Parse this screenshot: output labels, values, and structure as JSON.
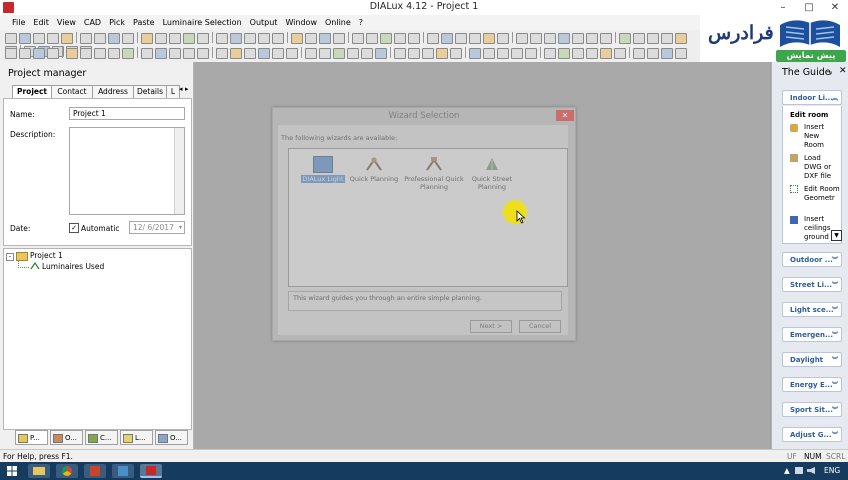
{
  "window": {
    "title": "DIALux 4.12 - Project 1",
    "buttons": {
      "minimize": "–",
      "maximize": "□",
      "close": "✕"
    }
  },
  "menu": [
    "File",
    "Edit",
    "View",
    "CAD",
    "Pick",
    "Paste",
    "Luminaire Selection",
    "Output",
    "Window",
    "Online",
    "?"
  ],
  "logo": {
    "text": "فرادرس",
    "subtitle": "پیش نمایش",
    "color": "#1e3a78",
    "badge_color": "#3da64a"
  },
  "project_manager": {
    "title": "Project manager",
    "tabs": [
      "Project",
      "Contact",
      "Address",
      "Details",
      "L"
    ],
    "active_tab": "Project",
    "form": {
      "name_label": "Name:",
      "name_value": "Project 1",
      "description_label": "Description:",
      "date_label": "Date:",
      "automatic_label": "Automatic",
      "automatic_checked": true,
      "date_value": "12/ 6/2017"
    },
    "tree": {
      "root": "Project 1",
      "child": "Luminaires Used"
    },
    "bottom_tabs": [
      "P...",
      "O...",
      "C...",
      "L...",
      "O..."
    ]
  },
  "dialog": {
    "title": "Wizard Selection",
    "close": "✕",
    "prompt": "The following wizards are available:",
    "wizards": [
      {
        "label": "DIALux Light",
        "selected": true
      },
      {
        "label": "Quick Planning",
        "selected": false
      },
      {
        "label": "Professional Quick Planning",
        "selected": false
      },
      {
        "label": "Quick Street Planning",
        "selected": false
      }
    ],
    "description": "This wizard guides you through an entire simple planning.",
    "next_label": "Next >",
    "cancel_label": "Cancel"
  },
  "guide": {
    "title": "The Guide",
    "pin": "ᵩ",
    "close": "✕",
    "indoor_section": "Indoor Li...",
    "indoor_heading": "Edit room",
    "indoor_items": [
      "Insert New Room",
      "Load DWG or DXF file",
      "Edit Room Geometr",
      "Insert ceilings ground"
    ],
    "sections": [
      "Outdoor ...",
      "Street Li...",
      "Light sce...",
      "Emergen...",
      "Daylight",
      "Energy E...",
      "Sport Sit...",
      "Adjust G..."
    ]
  },
  "statusbar": {
    "help_text": "For Help, press F1.",
    "indicators": [
      "UF",
      "NUM",
      "SCRL"
    ]
  },
  "taskbar": {
    "language": "ENG",
    "tray_arrow": "▲"
  },
  "colors": {
    "accent_blue": "#2d5e9a",
    "taskbar": "#153c5e",
    "cursor_highlight": "#f1e10d"
  }
}
